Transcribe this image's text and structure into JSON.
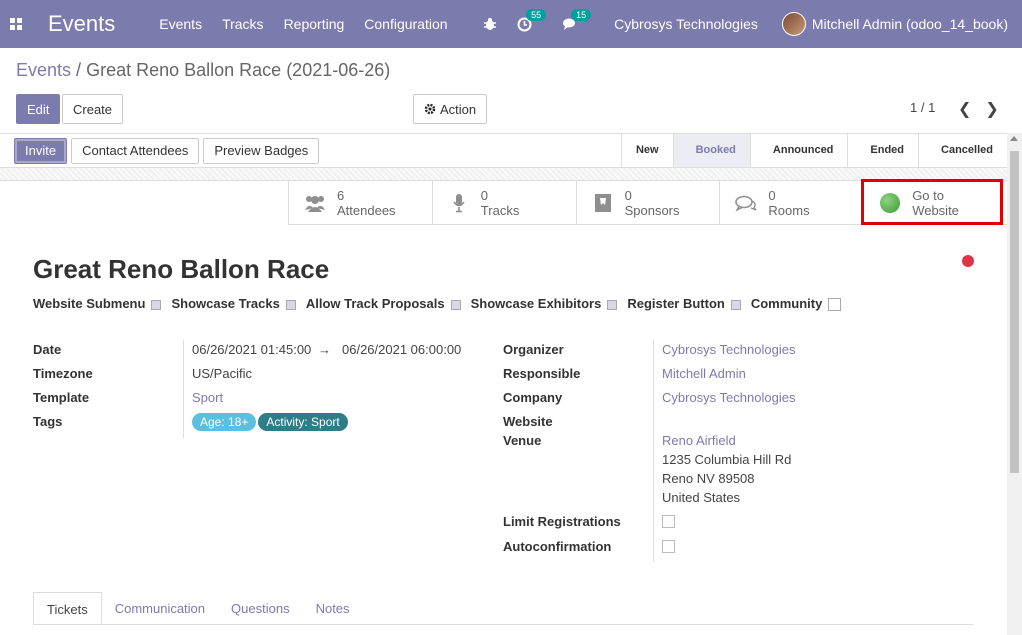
{
  "navbar": {
    "app_title": "Events",
    "menu": [
      "Events",
      "Tracks",
      "Reporting",
      "Configuration"
    ],
    "activity_count": "55",
    "message_count": "15",
    "company": "Cybrosys Technologies",
    "user": "Mitchell Admin (odoo_14_book)"
  },
  "breadcrumb": {
    "parent": "Events",
    "separator": "/",
    "current": "Great Reno Ballon Race (2021-06-26)"
  },
  "control_panel": {
    "edit": "Edit",
    "create": "Create",
    "action": "Action",
    "pager": "1 / 1"
  },
  "statusbar": {
    "buttons": [
      "Invite",
      "Contact Attendees",
      "Preview Badges"
    ],
    "stages": [
      "New",
      "Booked",
      "Announced",
      "Ended",
      "Cancelled"
    ],
    "active_stage": "Booked"
  },
  "smart_buttons": [
    {
      "count": "6",
      "label": "Attendees",
      "icon": "users-icon"
    },
    {
      "count": "0",
      "label": "Tracks",
      "icon": "microphone-icon"
    },
    {
      "count": "0",
      "label": "Sponsors",
      "icon": "sponsor-badge-icon"
    },
    {
      "count": "0",
      "label": "Rooms",
      "icon": "chat-rooms-icon"
    },
    {
      "line1": "Go to",
      "line2": "Website",
      "icon": "globe-icon"
    }
  ],
  "event": {
    "name": "Great Reno Ballon Race",
    "options": [
      {
        "label": "Website Submenu",
        "checked": true
      },
      {
        "label": "Showcase Tracks",
        "checked": true
      },
      {
        "label": "Allow Track Proposals",
        "checked": true
      },
      {
        "label": "Showcase Exhibitors",
        "checked": true
      },
      {
        "label": "Register Button",
        "checked": true
      },
      {
        "label": "Community",
        "checked": false
      }
    ],
    "left_fields": {
      "date_label": "Date",
      "date_start": "06/26/2021 01:45:00",
      "date_arrow": "→",
      "date_end": "06/26/2021 06:00:00",
      "timezone_label": "Timezone",
      "timezone": "US/Pacific",
      "template_label": "Template",
      "template": "Sport",
      "tags_label": "Tags",
      "tags": [
        "Age: 18+",
        "Activity: Sport"
      ]
    },
    "right_fields": {
      "organizer_label": "Organizer",
      "organizer": "Cybrosys Technologies",
      "responsible_label": "Responsible",
      "responsible": "Mitchell Admin",
      "company_label": "Company",
      "company": "Cybrosys Technologies",
      "website_label": "Website",
      "venue_label": "Venue",
      "venue_name": "Reno Airfield",
      "venue_street": "1235 Columbia Hill Rd",
      "venue_city": "Reno NV 89508",
      "venue_country": "United States",
      "limit_label": "Limit Registrations",
      "autoconfirm_label": "Autoconfirmation"
    }
  },
  "tabs": [
    "Tickets",
    "Communication",
    "Questions",
    "Notes"
  ],
  "colors": {
    "brand": "#7c7bad",
    "tag_age": "#5bc0de",
    "tag_activity": "#2e7d87",
    "status_dot": "#dc3545",
    "highlight": "#e00000"
  }
}
